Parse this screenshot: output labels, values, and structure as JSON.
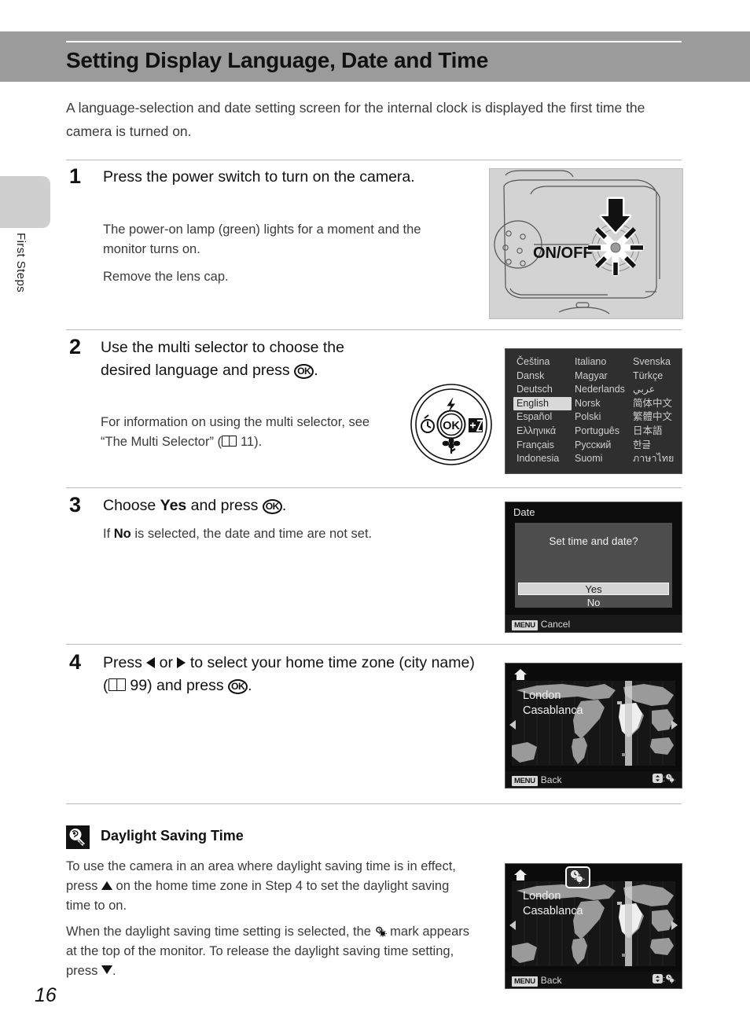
{
  "page": {
    "title": "Setting Display Language, Date and Time",
    "number": "16",
    "side_tab_label": "First Steps",
    "intro": "A language-selection and date setting screen for the internal clock is displayed the first time the camera is turned on."
  },
  "steps": [
    {
      "number": "1",
      "heading": "Press the power switch to turn on the camera.",
      "body": [
        "The power-on lamp (green) lights for a moment and the monitor turns on.",
        "Remove the lens cap."
      ],
      "figure": {
        "name": "camera-top-illustration",
        "label": "ON/OFF"
      }
    },
    {
      "number": "2",
      "heading_pre": "Use the multi selector to choose the desired language and press ",
      "heading_post": ".",
      "body_pre": "For information on using the multi selector, see “The Multi Selector” (",
      "body_post": " 11)."
    },
    {
      "number": "3",
      "heading_pre": "Choose ",
      "heading_bold": "Yes",
      "heading_mid": " and press ",
      "heading_post": ".",
      "body_pre": "If ",
      "body_bold": "No",
      "body_post": " is selected, the date and time are not set."
    },
    {
      "number": "4",
      "heading_a": "Press ",
      "heading_b": " or ",
      "heading_c": " to select your home time zone (city name) (",
      "heading_d": " 99) and press ",
      "heading_e": "."
    }
  ],
  "dial": {
    "center_label": "OK",
    "top_icon": "flash-icon",
    "left_icon": "self-timer-icon",
    "right_icon": "exposure-compensation-icon",
    "bottom_icon": "macro-icon"
  },
  "language_screen": {
    "name": "language-selection-screen",
    "selected": "English",
    "languages": [
      "Čeština",
      "Italiano",
      "Svenska",
      "Dansk",
      "Magyar",
      "Türkçe",
      "Deutsch",
      "Nederlands",
      "عربي",
      "English",
      "Norsk",
      "简体中文",
      "Español",
      "Polski",
      "繁體中文",
      "Ελληνικά",
      "Português",
      "日本語",
      "Français",
      "Русский",
      "한글",
      "Indonesia",
      "Suomi",
      "ภาษาไทย"
    ]
  },
  "date_screen": {
    "name": "date-confirm-screen",
    "title": "Date",
    "question": "Set time and date?",
    "yes_label": "Yes",
    "no_label": "No",
    "menu_chip": "MENU",
    "footer_label": "Cancel"
  },
  "map_screen": {
    "name": "time-zone-map-screen",
    "city_line1": "London",
    "city_line2": "Casablanca",
    "menu_chip": "MENU",
    "footer_label": "Back",
    "footer_hint": ":",
    "home_icon": "home-icon",
    "dst_icon": "daylight-saving-icon",
    "updown_icon": "multi-selector-updown-icon"
  },
  "tip": {
    "icon": "lightbulb-tip-icon",
    "title": "Daylight Saving Time",
    "para1_a": "To use the camera in an area where daylight saving time is in effect, press ",
    "para1_b": " on the home time zone in Step 4 to set the daylight saving time to on.",
    "para2_a": "When the daylight saving time setting is selected, the ",
    "para2_b": " mark appears at the top of the monitor. To release the daylight saving time setting, press ",
    "para2_c": "."
  },
  "colors": {
    "header_band": "#9b9b9b",
    "side_tab": "#cfcfcf",
    "body_text": "#3a3a3a",
    "heading_text": "#111111",
    "lcd_dark": "#0c0c0c",
    "lcd_language_bg": "#2f2f2f",
    "selection_highlight": "#d9d9d9"
  }
}
